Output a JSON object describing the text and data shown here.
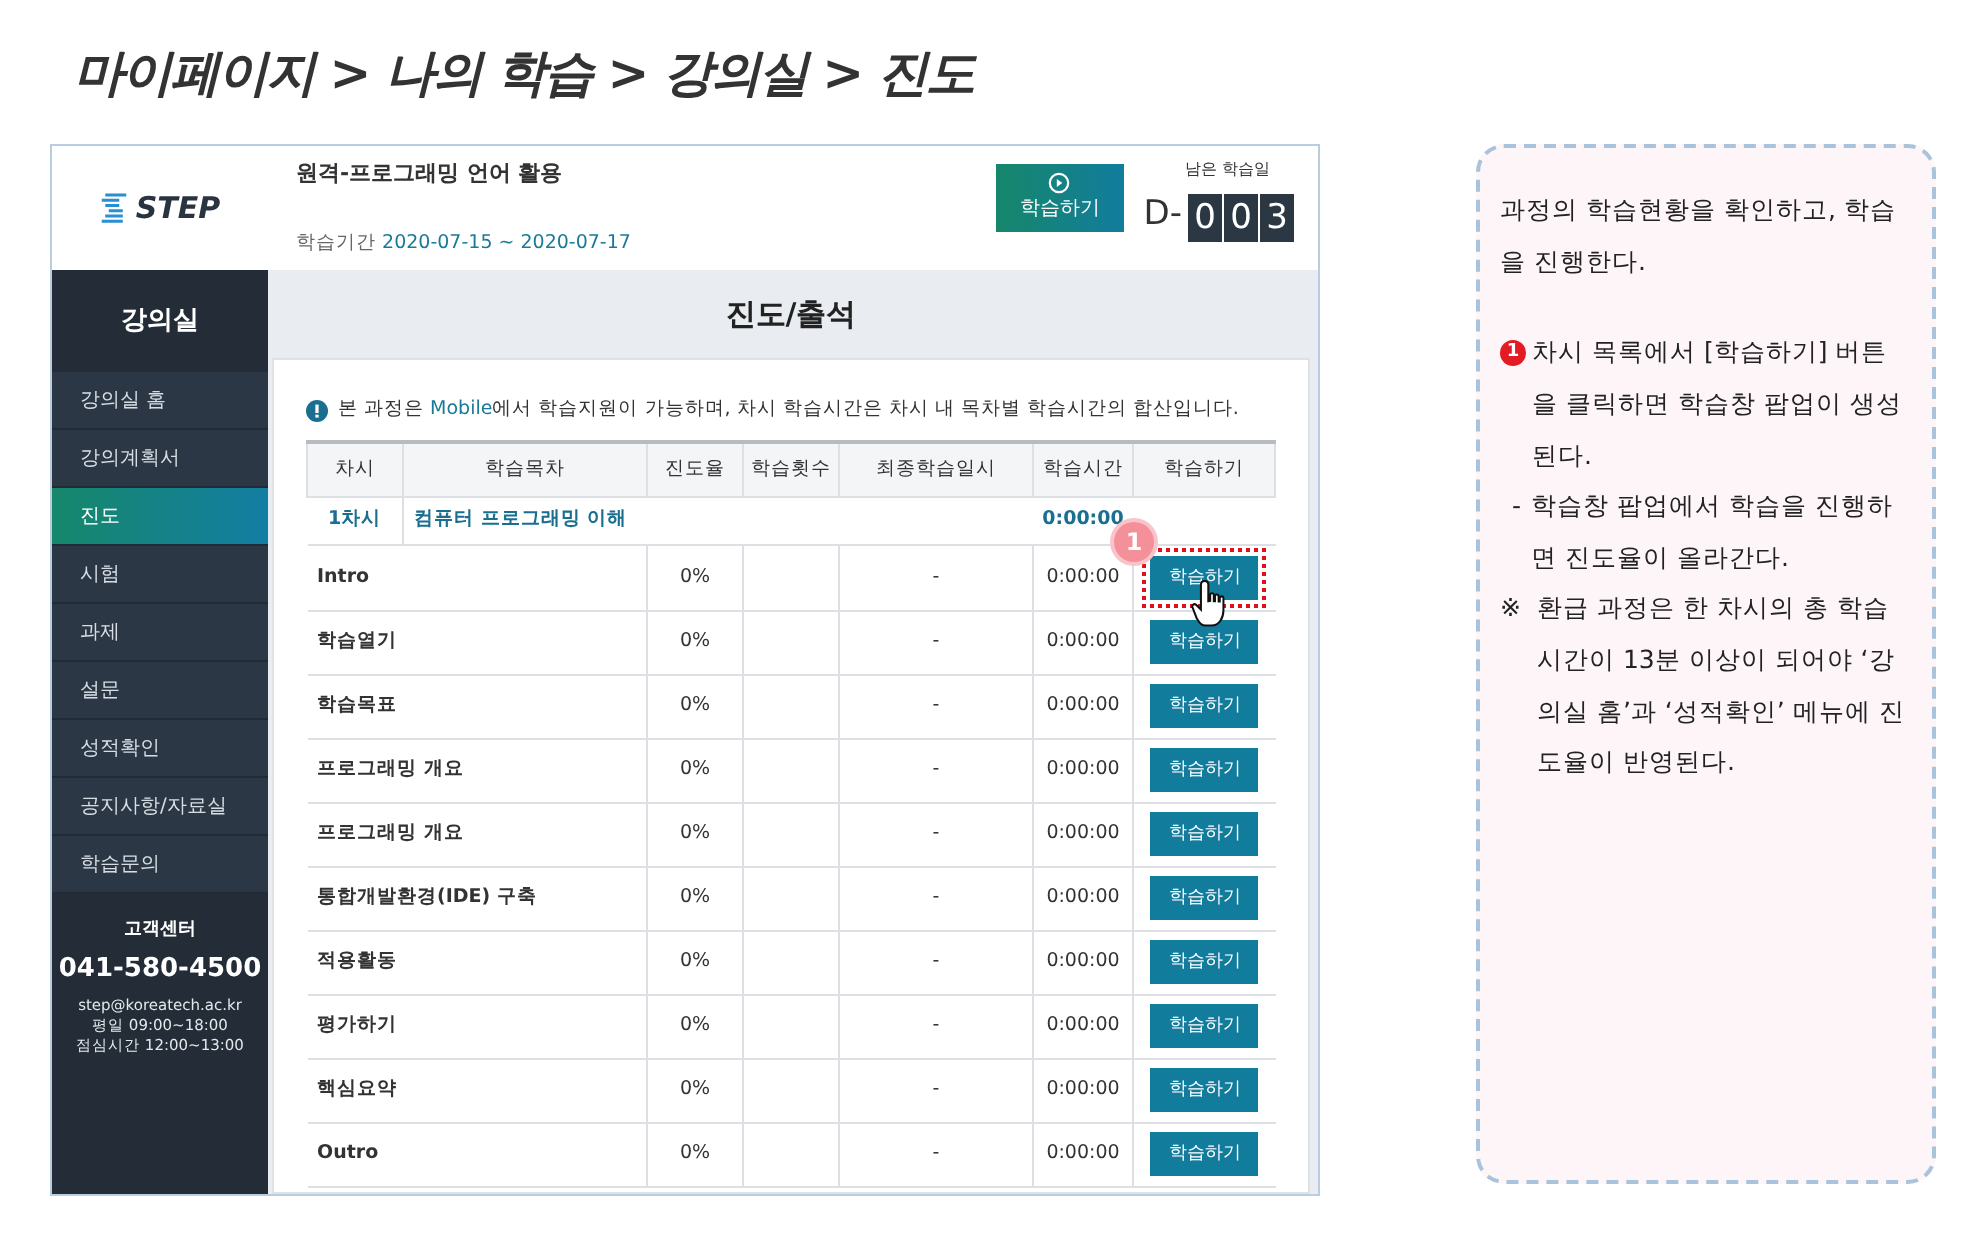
{
  "breadcrumb": "마이페이지 > 나의 학습 > 강의실 > 진도",
  "header": {
    "logo": "STEP",
    "course_title": "원격-프로그래밍 언어 활용",
    "period_label": "학습기간",
    "period": "2020-07-15 ~ 2020-07-17",
    "study_button": "학습하기",
    "remaining_label": "남은 학습일",
    "d_prefix": "D-",
    "d_digits": [
      "0",
      "0",
      "3"
    ]
  },
  "sidebar": {
    "title": "강의실",
    "items": [
      {
        "label": "강의실 홈",
        "selected": false
      },
      {
        "label": "강의계획서",
        "selected": false
      },
      {
        "label": "진도",
        "selected": true
      },
      {
        "label": "시험",
        "selected": false
      },
      {
        "label": "과제",
        "selected": false
      },
      {
        "label": "설문",
        "selected": false
      },
      {
        "label": "성적확인",
        "selected": false
      },
      {
        "label": "공지사항/자료실",
        "selected": false
      },
      {
        "label": "학습문의",
        "selected": false
      }
    ],
    "support": {
      "title": "고객센터",
      "phone": "041-580-4500",
      "lines": [
        "step@koreatech.ac.kr",
        "평일 09:00~18:00",
        "점심시간 12:00~13:00"
      ]
    }
  },
  "page_title": "진도/출석",
  "notice": [
    {
      "text": "본 과정은 ",
      "highlight": false
    },
    {
      "text": "Mobile",
      "highlight": true
    },
    {
      "text": "에서 학습지원이 가능하며, 차시 학습시간은 차시 내 목차별 학습시간의 합산입니다.",
      "highlight": false
    }
  ],
  "table": {
    "columns": [
      "차시",
      "학습목차",
      "진도율",
      "학습횟수",
      "최종학습일시",
      "학습시간",
      "학습하기"
    ],
    "rows": [
      {
        "kind": "chapter",
        "session": "1차시",
        "title": "컴퓨터 프로그래밍 이해",
        "time": "0:00:00"
      },
      {
        "kind": "item",
        "title": "Intro",
        "progress": "0%",
        "last": "-",
        "time": "0:00:00",
        "button": "학습하기",
        "highlighted": true
      },
      {
        "kind": "item",
        "title": "학습열기",
        "progress": "0%",
        "last": "-",
        "time": "0:00:00",
        "button": "학습하기",
        "highlighted": false
      },
      {
        "kind": "item",
        "title": "학습목표",
        "progress": "0%",
        "last": "-",
        "time": "0:00:00",
        "button": "학습하기",
        "highlighted": false
      },
      {
        "kind": "item",
        "title": "프로그래밍 개요",
        "progress": "0%",
        "last": "-",
        "time": "0:00:00",
        "button": "학습하기",
        "highlighted": false
      },
      {
        "kind": "item",
        "title": "프로그래밍 개요",
        "progress": "0%",
        "last": "-",
        "time": "0:00:00",
        "button": "학습하기",
        "highlighted": false
      },
      {
        "kind": "item",
        "title": "통합개발환경(IDE) 구축",
        "progress": "0%",
        "last": "-",
        "time": "0:00:00",
        "button": "학습하기",
        "highlighted": false
      },
      {
        "kind": "item",
        "title": "적용활동",
        "progress": "0%",
        "last": "-",
        "time": "0:00:00",
        "button": "학습하기",
        "highlighted": false
      },
      {
        "kind": "item",
        "title": "평가하기",
        "progress": "0%",
        "last": "-",
        "time": "0:00:00",
        "button": "학습하기",
        "highlighted": false
      },
      {
        "kind": "item",
        "title": "핵심요약",
        "progress": "0%",
        "last": "-",
        "time": "0:00:00",
        "button": "학습하기",
        "highlighted": false
      },
      {
        "kind": "item",
        "title": "Outro",
        "progress": "0%",
        "last": "-",
        "time": "0:00:00",
        "button": "학습하기",
        "highlighted": false
      }
    ]
  },
  "annotation_badge": "1",
  "callout": {
    "intro": "과정의 학습현황을 확인하고, 학습을 진행한다.",
    "steps": [
      {
        "marker": "1",
        "text": "차시 목록에서 [학습하기] 버튼을 클릭하면 학습창 팝업이 생성된다.",
        "notes": [
          {
            "kind": "dash",
            "symbol": "-",
            "text": "학습창 팝업에서 학습을 진행하면 진도율이 올라간다."
          },
          {
            "kind": "reference",
            "symbol": "※",
            "text": "환급 과정은 한 차시의 총 학습시간이 13분 이상이 되어야 ‘강의실 홈’과 ‘성적확인’ 메뉴에 진도율이 반영된다."
          }
        ]
      }
    ]
  }
}
